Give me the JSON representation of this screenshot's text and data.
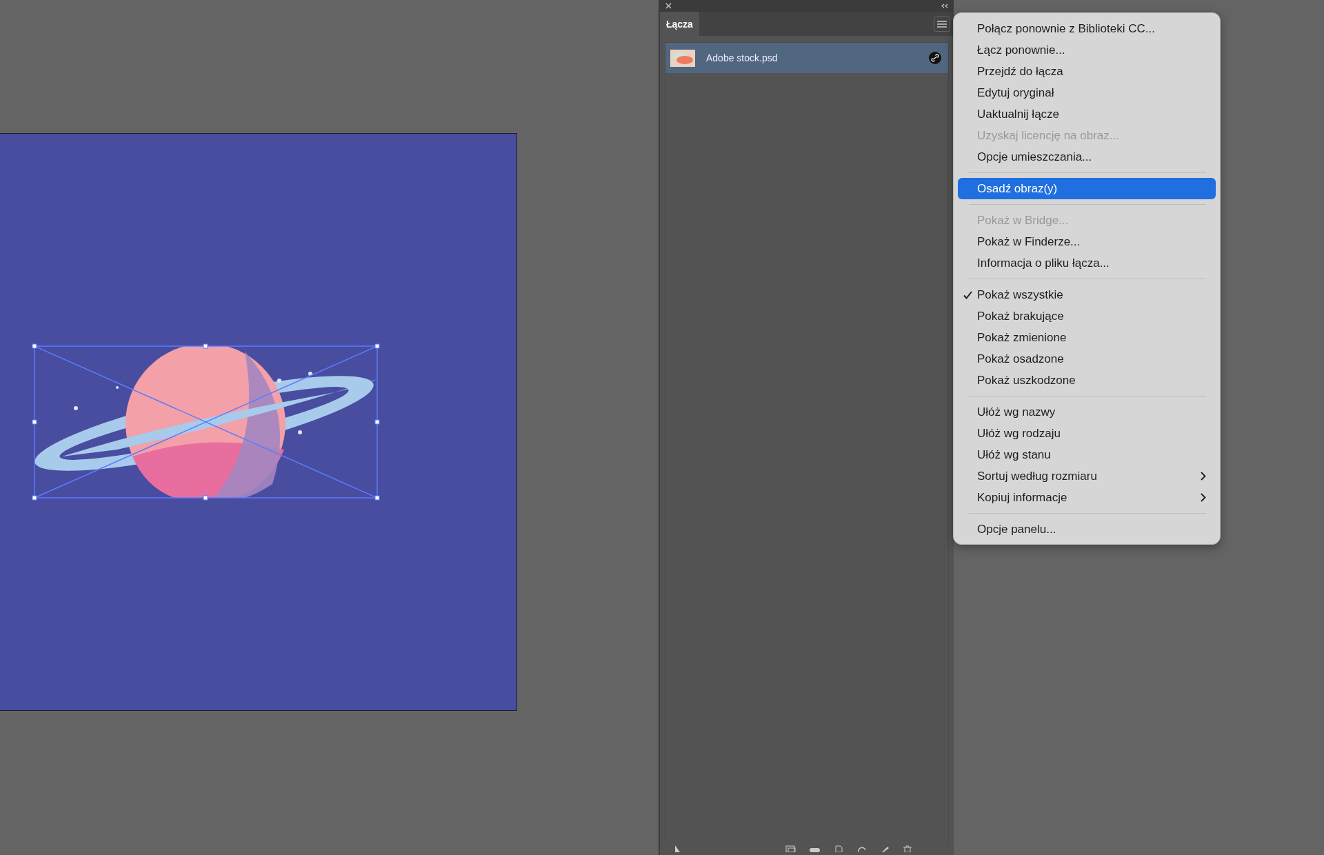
{
  "canvas": {
    "placed_image": {
      "kind": "picture",
      "selected": true
    }
  },
  "panel": {
    "tab": {
      "label": "Łącza",
      "selected": true
    },
    "links": [
      {
        "name": "Adobe stock.psd",
        "selected": true
      }
    ]
  },
  "menu": {
    "items": [
      {
        "kind": "item",
        "label": "Połącz ponownie z Biblioteki CC...",
        "disabled": false,
        "selected": false,
        "checked": false,
        "submenu": false
      },
      {
        "kind": "item",
        "label": "Łącz ponownie...",
        "disabled": false,
        "selected": false,
        "checked": false,
        "submenu": false
      },
      {
        "kind": "item",
        "label": "Przejdź do łącza",
        "disabled": false,
        "selected": false,
        "checked": false,
        "submenu": false
      },
      {
        "kind": "item",
        "label": "Edytuj oryginał",
        "disabled": false,
        "selected": false,
        "checked": false,
        "submenu": false
      },
      {
        "kind": "item",
        "label": "Uaktualnij łącze",
        "disabled": false,
        "selected": false,
        "checked": false,
        "submenu": false
      },
      {
        "kind": "item",
        "label": "Uzyskaj licencję na obraz...",
        "disabled": true,
        "selected": false,
        "checked": false,
        "submenu": false
      },
      {
        "kind": "item",
        "label": "Opcje umieszczania...",
        "disabled": false,
        "selected": false,
        "checked": false,
        "submenu": false
      },
      {
        "kind": "separator"
      },
      {
        "kind": "item",
        "label": "Osadź obraz(y)",
        "disabled": false,
        "selected": true,
        "checked": false,
        "submenu": false
      },
      {
        "kind": "separator"
      },
      {
        "kind": "item",
        "label": "Pokaż w Bridge...",
        "disabled": true,
        "selected": false,
        "checked": false,
        "submenu": false
      },
      {
        "kind": "item",
        "label": "Pokaż w Finderze...",
        "disabled": false,
        "selected": false,
        "checked": false,
        "submenu": false
      },
      {
        "kind": "item",
        "label": "Informacja o pliku łącza...",
        "disabled": false,
        "selected": false,
        "checked": false,
        "submenu": false
      },
      {
        "kind": "separator"
      },
      {
        "kind": "item",
        "label": "Pokaż wszystkie",
        "disabled": false,
        "selected": false,
        "checked": true,
        "submenu": false
      },
      {
        "kind": "item",
        "label": "Pokaż brakujące",
        "disabled": false,
        "selected": false,
        "checked": false,
        "submenu": false
      },
      {
        "kind": "item",
        "label": "Pokaż zmienione",
        "disabled": false,
        "selected": false,
        "checked": false,
        "submenu": false
      },
      {
        "kind": "item",
        "label": "Pokaż osadzone",
        "disabled": false,
        "selected": false,
        "checked": false,
        "submenu": false
      },
      {
        "kind": "item",
        "label": "Pokaż uszkodzone",
        "disabled": false,
        "selected": false,
        "checked": false,
        "submenu": false
      },
      {
        "kind": "separator"
      },
      {
        "kind": "item",
        "label": "Ułóż wg nazwy",
        "disabled": false,
        "selected": false,
        "checked": false,
        "submenu": false
      },
      {
        "kind": "item",
        "label": "Ułóż wg rodzaju",
        "disabled": false,
        "selected": false,
        "checked": false,
        "submenu": false
      },
      {
        "kind": "item",
        "label": "Ułóż wg stanu",
        "disabled": false,
        "selected": false,
        "checked": false,
        "submenu": false
      },
      {
        "kind": "item",
        "label": "Sortuj według rozmiaru",
        "disabled": false,
        "selected": false,
        "checked": false,
        "submenu": true
      },
      {
        "kind": "item",
        "label": "Kopiuj informacje",
        "disabled": false,
        "selected": false,
        "checked": false,
        "submenu": true
      },
      {
        "kind": "separator"
      },
      {
        "kind": "item",
        "label": "Opcje panelu...",
        "disabled": false,
        "selected": false,
        "checked": false,
        "submenu": false
      }
    ]
  }
}
